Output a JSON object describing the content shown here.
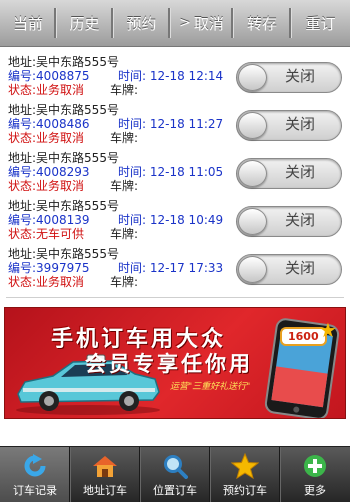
{
  "tabs": [
    {
      "label": "当前",
      "arrow": false
    },
    {
      "label": "历史",
      "arrow": false
    },
    {
      "label": "预约",
      "arrow": false
    },
    {
      "label": "取消",
      "arrow": true
    },
    {
      "label": "转存",
      "arrow": false
    },
    {
      "label": "重订",
      "arrow": false
    }
  ],
  "labels": {
    "address": "地址:",
    "number": "编号:",
    "time": "时间:",
    "status": "状态:",
    "plate": "车牌:"
  },
  "orders": [
    {
      "address": "吴中东路555号",
      "number": "4008875",
      "time": "12-18 12:14",
      "status": "业务取消",
      "plate": "",
      "toggle": "关闭"
    },
    {
      "address": "吴中东路555号",
      "number": "4008486",
      "time": "12-18 11:27",
      "status": "业务取消",
      "plate": "",
      "toggle": "关闭"
    },
    {
      "address": "吴中东路555号",
      "number": "4008293",
      "time": "12-18 11:05",
      "status": "业务取消",
      "plate": "",
      "toggle": "关闭"
    },
    {
      "address": "吴中东路555号",
      "number": "4008139",
      "time": "12-18 10:49",
      "status": "无车可供",
      "plate": "",
      "toggle": "关闭"
    },
    {
      "address": "吴中东路555号",
      "number": "3997975",
      "time": "12-17 17:33",
      "status": "业务取消",
      "plate": "",
      "toggle": "关闭"
    }
  ],
  "banner": {
    "title": "手机订车用大众",
    "subtitle": "会员专享任你用",
    "slogan": "运营\"三重好礼送行\"",
    "badge": "1600"
  },
  "bottom_nav": [
    {
      "label": "订车记录",
      "icon": "refresh-icon",
      "active": true
    },
    {
      "label": "地址订车",
      "icon": "home-icon",
      "active": false
    },
    {
      "label": "位置订车",
      "icon": "search-icon",
      "active": false
    },
    {
      "label": "预约订车",
      "icon": "star-icon",
      "active": false
    },
    {
      "label": "更多",
      "icon": "plus-icon",
      "active": false
    }
  ],
  "colors": {
    "status": "#d01010",
    "value": "#1a33c8",
    "banner": "#d42020"
  }
}
